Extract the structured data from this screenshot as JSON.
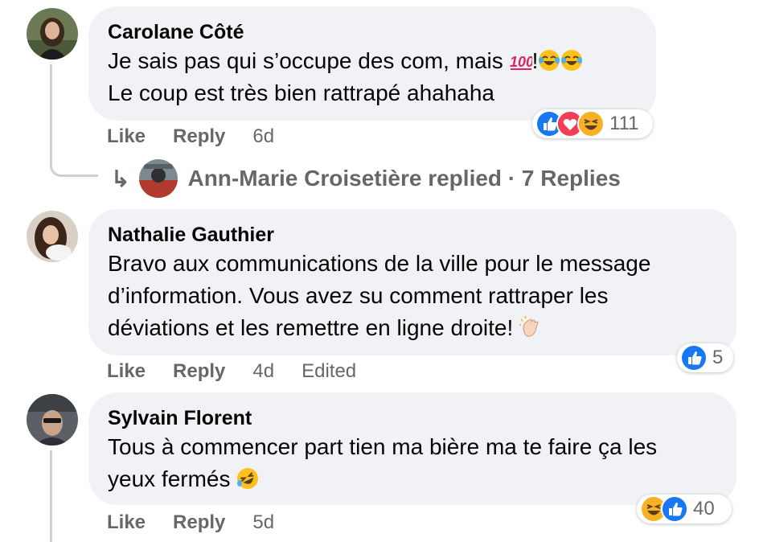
{
  "comments": [
    {
      "author": "Carolane Côté",
      "lines": [
        "Je sais pas qui s’occupe des com, mais ",
        "Le coup est très bien rattrapé ahahaha"
      ],
      "line1_suffix": "!",
      "emoji_icons": [
        "hundred-points-emoji",
        "tears-of-joy-emoji",
        "tears-of-joy-emoji"
      ],
      "actions": {
        "like": "Like",
        "reply": "Reply",
        "time": "6d"
      },
      "reactions": {
        "icons": [
          "like-reaction-icon",
          "love-reaction-icon",
          "haha-reaction-icon"
        ],
        "count": "111"
      },
      "replies": {
        "text": "Ann-Marie Croisetière replied · 7 Replies"
      }
    },
    {
      "author": "Nathalie Gauthier",
      "lines": [
        "Bravo aux communications de la ville pour le message",
        "d’information. Vous avez su comment rattraper les",
        "déviations et les remettre en ligne droite! "
      ],
      "emoji_icons": [
        "clapping-hands-emoji"
      ],
      "actions": {
        "like": "Like",
        "reply": "Reply",
        "time": "4d",
        "edited": "Edited"
      },
      "reactions": {
        "icons": [
          "like-reaction-icon"
        ],
        "count": "5"
      }
    },
    {
      "author": "Sylvain Florent",
      "lines": [
        "Tous à commencer part tien ma bière ma te faire ça les",
        "yeux fermés "
      ],
      "emoji_icons": [
        "rolling-laughing-emoji"
      ],
      "actions": {
        "like": "Like",
        "reply": "Reply",
        "time": "5d"
      },
      "reactions": {
        "icons": [
          "haha-reaction-icon",
          "like-reaction-icon"
        ],
        "count": "40"
      }
    }
  ],
  "colors": {
    "bubble": "#f0f2f5",
    "like_blue": "#1877f2",
    "love_red": "#f33e58",
    "haha_yellow": "#f7b125",
    "meta_gray": "#65676b"
  }
}
